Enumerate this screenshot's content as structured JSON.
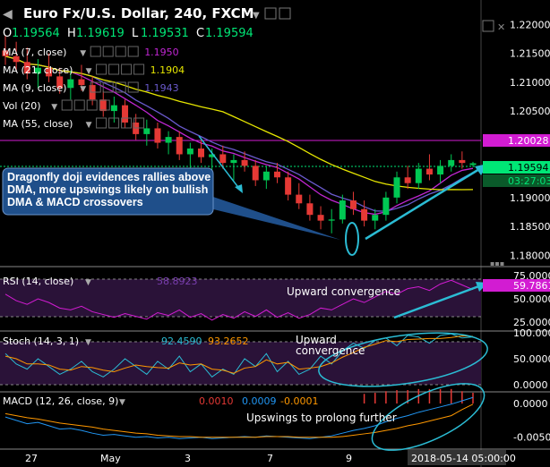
{
  "header": {
    "symbol": "Euro Fx/U.S. Dollar, 240, FXCM",
    "ohlc": [
      {
        "k": "O",
        "v": "1.19564"
      },
      {
        "k": "H",
        "v": "1.19619"
      },
      {
        "k": "L",
        "v": "1.19531"
      },
      {
        "k": "C",
        "v": "1.19594"
      }
    ]
  },
  "indicators": [
    {
      "label": "MA (7, close)",
      "value": "1.1950",
      "color": "#c026d3"
    },
    {
      "label": "MA (21, close)",
      "value": "1.1904",
      "color": "#e6e600"
    },
    {
      "label": "MA (9, close)",
      "value": "1.1943",
      "color": "#6a5acd"
    },
    {
      "label": "Vol (20)",
      "value": "",
      "color": "#2bbcd4"
    },
    {
      "label": "MA (55, close)",
      "value": "",
      "color": "#2bbcd4"
    }
  ],
  "annotations": {
    "callout": "Dragonfly doji evidences rallies above DMA, more upswings likely on bullish DMA & MACD crossovers",
    "rsi_note": "Upward convergence",
    "stoch_note": "Upward convergence",
    "macd_note": "Upswings to prolong further"
  },
  "price_axis": {
    "ticks": [
      "1.22000",
      "1.21500",
      "1.21000",
      "1.20500",
      "1.19500",
      "1.19000",
      "1.18500",
      "1.18000"
    ],
    "marker_resistance": "1.20028",
    "marker_last": "1.19594",
    "marker_countdown": "03:27:03"
  },
  "rsi": {
    "label": "RSI (14, close)",
    "value": "58.8923",
    "marker": "59.7861",
    "ticks": [
      "75.0000",
      "50.0000",
      "25.0000"
    ]
  },
  "stoch": {
    "label": "Stoch (14, 3, 1)",
    "k": "92.4590",
    "d": "93.2652",
    "ticks": [
      "100.0000",
      "50.0000",
      "0.0000"
    ]
  },
  "macd": {
    "label": "MACD (12, 26, close, 9)",
    "hist": "0.0010",
    "macd": "0.0009",
    "signal": "-0.0001",
    "ticks": [
      "0.0000",
      "-0.0050"
    ]
  },
  "time_axis": {
    "labels": [
      "27",
      "May",
      "3",
      "7",
      "9"
    ],
    "cursor": "2018-05-14 05:00:00"
  },
  "colors": {
    "bull": "#00c853",
    "bear": "#e53935",
    "ma7": "#c026d3",
    "ma21": "#e6e600",
    "ma9": "#6a5acd",
    "cyan": "#2bbcd4",
    "magenta": "#d21cd2",
    "green": "#00e676",
    "panel_fill": "#2a1238"
  },
  "chart_data": [
    {
      "type": "candlestick",
      "title": "Euro Fx/U.S. Dollar, 240, FXCM",
      "ylim": [
        1.1785,
        1.223
      ],
      "candles": [
        [
          1.2155,
          1.218,
          1.213,
          1.2145
        ],
        [
          1.2145,
          1.217,
          1.212,
          1.2135
        ],
        [
          1.2135,
          1.216,
          1.2105,
          1.2115
        ],
        [
          1.2115,
          1.214,
          1.209,
          1.2125
        ],
        [
          1.2125,
          1.215,
          1.21,
          1.211
        ],
        [
          1.211,
          1.2125,
          1.208,
          1.209
        ],
        [
          1.209,
          1.212,
          1.207,
          1.2105
        ],
        [
          1.2105,
          1.213,
          1.2085,
          1.2095
        ],
        [
          1.2095,
          1.211,
          1.206,
          1.207
        ],
        [
          1.207,
          1.2085,
          1.204,
          1.205
        ],
        [
          1.205,
          1.2075,
          1.203,
          1.206
        ],
        [
          1.206,
          1.207,
          1.202,
          1.203
        ],
        [
          1.203,
          1.2045,
          1.2,
          1.201
        ],
        [
          1.201,
          1.2035,
          1.199,
          1.202
        ],
        [
          1.202,
          1.203,
          1.1985,
          1.1995
        ],
        [
          1.1995,
          1.2015,
          1.1975,
          1.2005
        ],
        [
          1.2005,
          1.2015,
          1.1965,
          1.1975
        ],
        [
          1.1975,
          1.1995,
          1.195,
          1.1985
        ],
        [
          1.1985,
          1.2,
          1.196,
          1.197
        ],
        [
          1.197,
          1.1985,
          1.194,
          1.1975
        ],
        [
          1.1975,
          1.199,
          1.195,
          1.196
        ],
        [
          1.196,
          1.1975,
          1.193,
          1.1965
        ],
        [
          1.1965,
          1.198,
          1.1945,
          1.1955
        ],
        [
          1.1955,
          1.1965,
          1.192,
          1.193
        ],
        [
          1.193,
          1.1955,
          1.1915,
          1.1945
        ],
        [
          1.1945,
          1.196,
          1.1925,
          1.1935
        ],
        [
          1.1935,
          1.1945,
          1.1895,
          1.1905
        ],
        [
          1.1905,
          1.1925,
          1.188,
          1.189
        ],
        [
          1.189,
          1.1905,
          1.186,
          1.187
        ],
        [
          1.187,
          1.1885,
          1.1845,
          1.186
        ],
        [
          1.186,
          1.188,
          1.1838,
          1.1862
        ],
        [
          1.1862,
          1.1905,
          1.1855,
          1.1895
        ],
        [
          1.1895,
          1.191,
          1.187,
          1.188
        ],
        [
          1.188,
          1.1895,
          1.185,
          1.186
        ],
        [
          1.186,
          1.188,
          1.1845,
          1.187
        ],
        [
          1.187,
          1.191,
          1.186,
          1.19
        ],
        [
          1.19,
          1.1945,
          1.189,
          1.1935
        ],
        [
          1.1935,
          1.1955,
          1.1915,
          1.1925
        ],
        [
          1.1925,
          1.196,
          1.1915,
          1.195
        ],
        [
          1.195,
          1.1975,
          1.193,
          1.194
        ],
        [
          1.194,
          1.1965,
          1.1925,
          1.1955
        ],
        [
          1.1955,
          1.1975,
          1.1945,
          1.1965
        ],
        [
          1.1965,
          1.198,
          1.195,
          1.196
        ],
        [
          1.19564,
          1.19619,
          1.19531,
          1.19594
        ]
      ]
    },
    {
      "type": "line",
      "title": "RSI (14, close)",
      "ylim": [
        20,
        80
      ],
      "values": [
        55,
        48,
        44,
        50,
        46,
        40,
        38,
        42,
        36,
        33,
        30,
        34,
        31,
        28,
        35,
        32,
        38,
        30,
        34,
        27,
        33,
        29,
        36,
        31,
        38,
        30,
        35,
        29,
        33,
        40,
        38,
        44,
        50,
        46,
        52,
        58,
        55,
        61,
        63,
        59,
        66,
        70,
        65,
        60
      ]
    },
    {
      "type": "line",
      "title": "Stoch (14, 3, 1)",
      "ylim": [
        0,
        100
      ],
      "k": [
        60,
        40,
        30,
        50,
        35,
        20,
        30,
        45,
        25,
        15,
        30,
        50,
        35,
        20,
        45,
        30,
        55,
        25,
        40,
        15,
        30,
        20,
        50,
        35,
        60,
        25,
        45,
        20,
        30,
        55,
        40,
        65,
        80,
        70,
        85,
        90,
        75,
        95,
        92,
        80,
        95,
        98,
        90,
        92
      ],
      "d": [
        55,
        50,
        40,
        40,
        38,
        30,
        28,
        35,
        33,
        28,
        25,
        32,
        38,
        35,
        33,
        32,
        42,
        38,
        40,
        30,
        28,
        22,
        32,
        35,
        48,
        40,
        43,
        30,
        32,
        35,
        42,
        53,
        62,
        72,
        78,
        85,
        83,
        87,
        88,
        89,
        89,
        91,
        94,
        93
      ]
    },
    {
      "type": "line",
      "title": "MACD (12, 26, close, 9)",
      "ylim": [
        -0.0065,
        0.0012
      ],
      "macd": [
        -0.002,
        -0.0025,
        -0.003,
        -0.0028,
        -0.0033,
        -0.0038,
        -0.0037,
        -0.004,
        -0.0044,
        -0.0047,
        -0.0046,
        -0.0048,
        -0.005,
        -0.0049,
        -0.0051,
        -0.005,
        -0.0052,
        -0.0051,
        -0.005,
        -0.0052,
        -0.0051,
        -0.005,
        -0.0049,
        -0.005,
        -0.0048,
        -0.0049,
        -0.005,
        -0.0051,
        -0.0052,
        -0.005,
        -0.0048,
        -0.0044,
        -0.004,
        -0.0037,
        -0.0033,
        -0.0027,
        -0.0022,
        -0.0018,
        -0.0013,
        -0.0009,
        -0.0005,
        -0.0001,
        0.0004,
        0.0009
      ],
      "signal": [
        -0.0015,
        -0.0018,
        -0.0021,
        -0.0023,
        -0.0026,
        -0.0029,
        -0.0031,
        -0.0033,
        -0.0035,
        -0.0038,
        -0.004,
        -0.0042,
        -0.0044,
        -0.0045,
        -0.0047,
        -0.0048,
        -0.0049,
        -0.0049,
        -0.005,
        -0.005,
        -0.005,
        -0.005,
        -0.005,
        -0.005,
        -0.0049,
        -0.0049,
        -0.0049,
        -0.005,
        -0.005,
        -0.005,
        -0.005,
        -0.0049,
        -0.0047,
        -0.0045,
        -0.0043,
        -0.004,
        -0.0037,
        -0.0033,
        -0.003,
        -0.0026,
        -0.0022,
        -0.0018,
        -0.0009,
        -0.0001
      ]
    }
  ]
}
